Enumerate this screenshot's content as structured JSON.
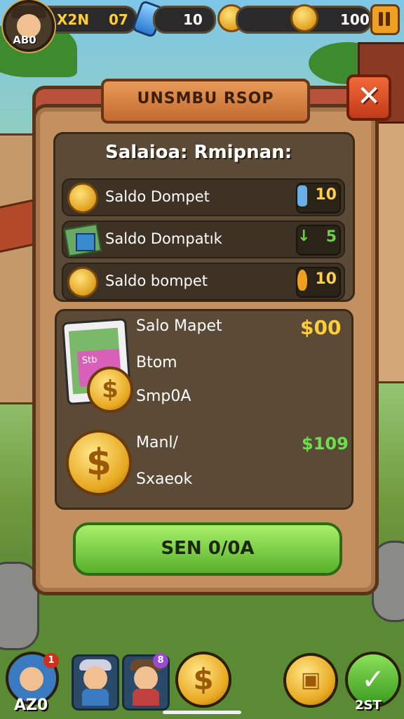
{
  "topbar": {
    "avatar_label": "AB0",
    "xp_label": "X2N",
    "level": "07",
    "gems": "10",
    "coins": "100"
  },
  "shop": {
    "title": "UNSMBU RSOP",
    "close_glyph": "✕",
    "subtitle": "Salaioa: Rmipnan:",
    "rows": [
      {
        "label": "Saldo Dompet",
        "value": "10",
        "icon": "coin-icon"
      },
      {
        "label": "Saldo Dompatık",
        "value": "5",
        "icon": "cash-icon"
      },
      {
        "label": "Saldo bompet",
        "value": "10",
        "icon": "coin-icon"
      }
    ],
    "offer": {
      "title": "Salo Mapet",
      "price": "$00",
      "line1": "Btom",
      "line2": "Smp0A",
      "bundle_text": "Stb",
      "title2": "Manl/",
      "price2": "$109",
      "line3": "Sxaeok"
    },
    "buy_button": "SEN 0/0A"
  },
  "bottombar": {
    "hero_badge": "1",
    "hero_label": "AZ0",
    "slot3_badge": "8",
    "right_label": "2ST"
  },
  "colors": {
    "accent_gold": "#ffce3a",
    "accent_green": "#6ae04a",
    "panel": "#c49060",
    "close": "#e04a24"
  }
}
